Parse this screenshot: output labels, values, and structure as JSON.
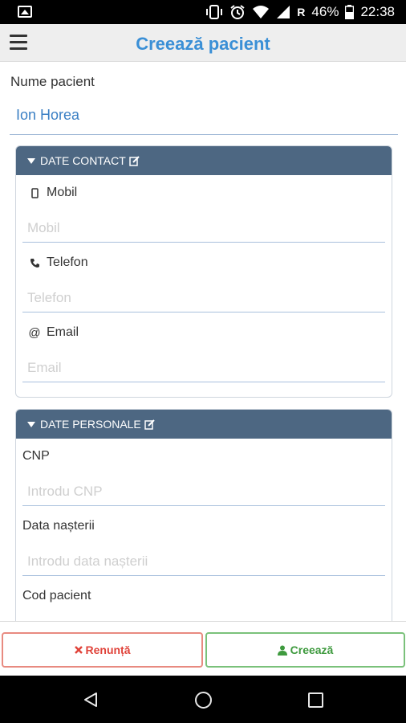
{
  "status_bar": {
    "carrier_letter": "R",
    "battery": "46%",
    "time": "22:38",
    "icons": [
      "image-icon",
      "vibrate-icon",
      "alarm-icon",
      "wifi-icon",
      "signal-icon",
      "battery-icon"
    ]
  },
  "app_bar": {
    "title": "Creează pacient",
    "menu_icon": "menu-icon"
  },
  "patient": {
    "name_label": "Nume pacient",
    "name_value": "Ion Horea"
  },
  "contact_panel": {
    "title": "DATE CONTACT",
    "fields": [
      {
        "label": "Mobil",
        "placeholder": "Mobil",
        "icon": "mobile-icon"
      },
      {
        "label": "Telefon",
        "placeholder": "Telefon",
        "icon": "phone-icon"
      },
      {
        "label": "Email",
        "placeholder": "Email",
        "icon": "at-icon"
      }
    ]
  },
  "personal_panel": {
    "title": "DATE PERSONALE",
    "fields": [
      {
        "label": "CNP",
        "placeholder": "Introdu CNP"
      },
      {
        "label": "Data nașterii",
        "placeholder": "Introdu data nașterii"
      },
      {
        "label": "Cod pacient",
        "placeholder": ""
      }
    ]
  },
  "actions": {
    "cancel_label": "Renunță",
    "create_label": "Creează"
  },
  "colors": {
    "accent": "#3a8fd6",
    "panel_header": "#4d6782",
    "cancel": "#e0433a",
    "create": "#3e9a3e"
  }
}
